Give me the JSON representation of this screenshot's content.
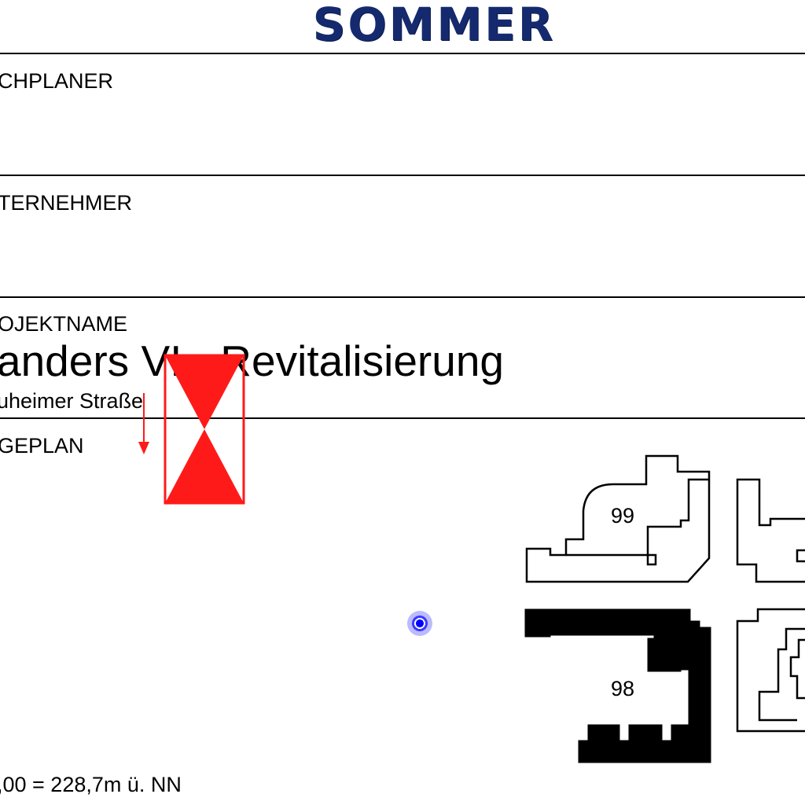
{
  "header": {
    "logo_text": "SOMMER"
  },
  "sections": {
    "fachplaner_label": "CHPLANER",
    "unternehmer_label": "TERNEHMER",
    "projektname_label": "OJEKTNAME",
    "project_title": "anders VI - Revitalisierung",
    "address": "uheimer Straße",
    "lageplan_label": "GEPLAN"
  },
  "site_plan": {
    "building_99_label": "99",
    "building_98_label": "98",
    "elevation_note": ",00 = 228,7m ü. NN"
  },
  "colors": {
    "logo": "#152a6e",
    "north_symbol": "#ff1a1a",
    "location_marker": "#0000ff"
  },
  "icons": {
    "north_symbol": "north-arrow-icon",
    "location_marker": "location-marker-icon"
  }
}
